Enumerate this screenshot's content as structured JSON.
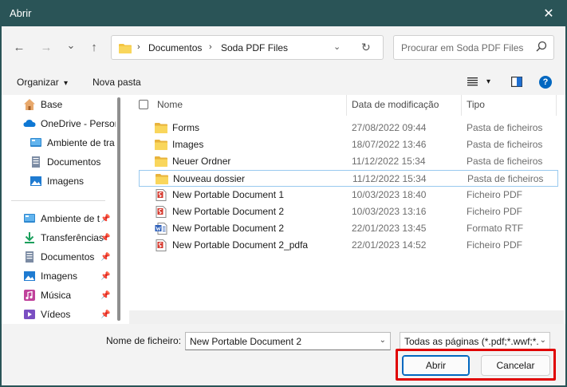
{
  "window": {
    "title": "Abrir",
    "close_glyph": "✕"
  },
  "navigation": {
    "back_glyph": "←",
    "forward_glyph": "→",
    "recent_glyph": "⌄",
    "up_glyph": "↑"
  },
  "address_bar": {
    "breadcrumbs": [
      "Documentos",
      "Soda PDF Files"
    ],
    "separator": "›",
    "dropdown_glyph": "⌄",
    "refresh_glyph": "↻"
  },
  "search": {
    "placeholder": "Procurar em Soda PDF Files"
  },
  "toolbar": {
    "organize_label": "Organizar",
    "organize_arrow": "▾",
    "new_folder_label": "Nova pasta",
    "view_arrow": "▾",
    "help_glyph": "?"
  },
  "sidebar": {
    "items": [
      {
        "label": "Base",
        "icon": "home-icon"
      },
      {
        "label": "OneDrive - Person",
        "icon": "onedrive-cloud-icon"
      },
      {
        "label": "Ambiente de tra",
        "icon": "desktop-icon"
      },
      {
        "label": "Documentos",
        "icon": "documents-icon"
      },
      {
        "label": "Imagens",
        "icon": "pictures-icon"
      },
      {
        "label": "Ambiente de t",
        "icon": "desktop-icon",
        "pinned": true
      },
      {
        "label": "Transferências",
        "icon": "downloads-icon",
        "pinned": true
      },
      {
        "label": "Documentos",
        "icon": "documents-icon",
        "pinned": true
      },
      {
        "label": "Imagens",
        "icon": "pictures-icon",
        "pinned": true
      },
      {
        "label": "Música",
        "icon": "music-icon",
        "pinned": true
      },
      {
        "label": "Vídeos",
        "icon": "videos-icon",
        "pinned": true
      }
    ],
    "pin_glyph": "📌"
  },
  "file_list": {
    "columns": {
      "name": "Nome",
      "date": "Data de modificação",
      "type": "Tipo"
    },
    "sort_glyph": "⌃",
    "rows": [
      {
        "name": "Forms",
        "date": "27/08/2022 09:44",
        "type": "Pasta de ficheiros",
        "icon": "folder-icon"
      },
      {
        "name": "Images",
        "date": "18/07/2022 13:46",
        "type": "Pasta de ficheiros",
        "icon": "folder-icon"
      },
      {
        "name": "Neuer Ordner",
        "date": "11/12/2022 15:34",
        "type": "Pasta de ficheiros",
        "icon": "folder-icon"
      },
      {
        "name": "Nouveau dossier",
        "date": "11/12/2022 15:34",
        "type": "Pasta de ficheiros",
        "icon": "folder-icon",
        "selected": true
      },
      {
        "name": "New Portable Document 1",
        "date": "10/03/2023 18:40",
        "type": "Ficheiro PDF",
        "icon": "pdf-file-icon"
      },
      {
        "name": "New Portable Document 2",
        "date": "10/03/2023 13:16",
        "type": "Ficheiro PDF",
        "icon": "pdf-file-icon"
      },
      {
        "name": "New Portable Document 2",
        "date": "22/01/2023 13:45",
        "type": "Formato RTF",
        "icon": "rtf-file-icon"
      },
      {
        "name": "New Portable Document 2_pdfa",
        "date": "22/01/2023 14:52",
        "type": "Ficheiro PDF",
        "icon": "pdf-file-icon"
      }
    ]
  },
  "footer": {
    "filename_label": "Nome de ficheiro:",
    "filename_value": "New Portable Document 2",
    "filter_value": "Todas as páginas (*.pdf;*.wwf;*.",
    "dropdown_glyph": "⌄",
    "open_label": "Abrir",
    "cancel_label": "Cancelar"
  },
  "colors": {
    "titlebar": "#2a5457",
    "highlight_box": "#e00000",
    "selection_border": "#99c9ef",
    "folder": "#f4c542",
    "pdf_red": "#d63a2f",
    "rtf_blue": "#2b5eb8",
    "help_blue": "#0067c0"
  }
}
